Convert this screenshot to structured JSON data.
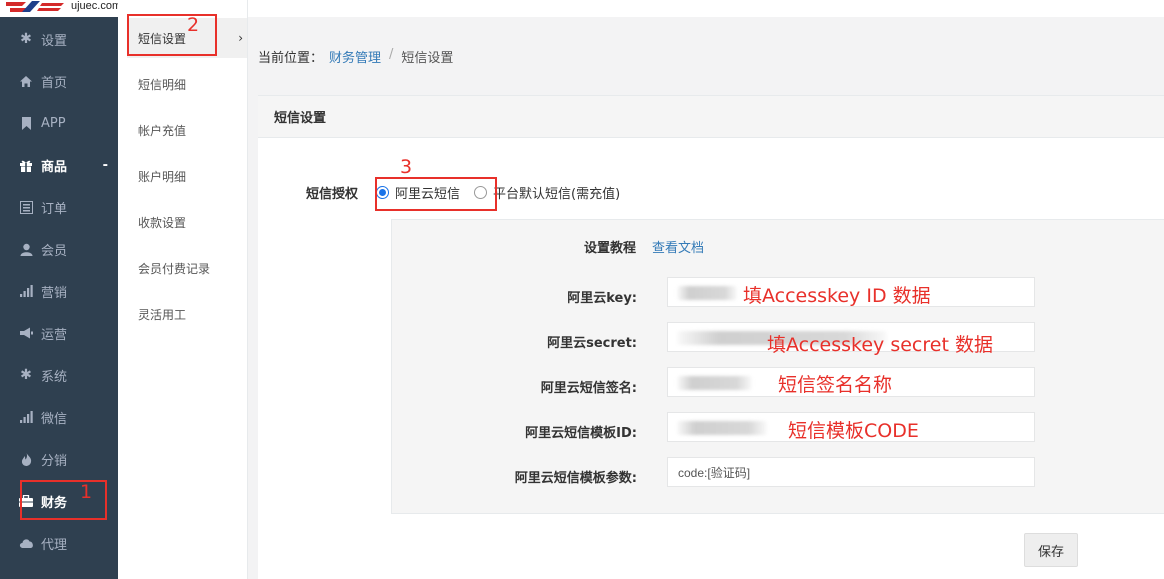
{
  "logo": {
    "text": "ujuec.com"
  },
  "sidebar": {
    "items": [
      {
        "label": "设置",
        "icon": "gear-icon"
      },
      {
        "label": "首页",
        "icon": "home-icon"
      },
      {
        "label": "APP",
        "icon": "bookmark-icon"
      },
      {
        "label": "商品",
        "icon": "gift-icon",
        "suffix": "-"
      },
      {
        "label": "订单",
        "icon": "list-icon"
      },
      {
        "label": "会员",
        "icon": "user-icon"
      },
      {
        "label": "营销",
        "icon": "bar-chart-icon"
      },
      {
        "label": "运营",
        "icon": "megaphone-icon"
      },
      {
        "label": "系统",
        "icon": "asterisk-icon"
      },
      {
        "label": "微信",
        "icon": "signal-icon"
      },
      {
        "label": "分销",
        "icon": "fire-icon"
      },
      {
        "label": "财务",
        "icon": "briefcase-icon"
      },
      {
        "label": "代理",
        "icon": "cloud-icon"
      }
    ]
  },
  "submenu": {
    "items": [
      {
        "label": "短信设置",
        "chevron": "›"
      },
      {
        "label": "短信明细"
      },
      {
        "label": "帐户充值"
      },
      {
        "label": "账户明细"
      },
      {
        "label": "收款设置"
      },
      {
        "label": "会员付费记录"
      },
      {
        "label": "灵活用工"
      }
    ]
  },
  "breadcrumb": {
    "prefix": "当前位置：",
    "parent": "财务管理",
    "separator": "/",
    "current": "短信设置"
  },
  "card": {
    "title": "短信设置",
    "auth_label": "短信授权",
    "options": [
      {
        "label": "阿里云短信",
        "selected": true
      },
      {
        "label": "平台默认短信(需充值)",
        "selected": false
      }
    ],
    "tutorial_label": "设置教程",
    "tutorial_link": "查看文档",
    "fields": [
      {
        "label": "阿里云key:",
        "value": ""
      },
      {
        "label": "阿里云secret:",
        "value": ""
      },
      {
        "label": "阿里云短信签名:",
        "value": ""
      },
      {
        "label": "阿里云短信模板ID:",
        "value": ""
      },
      {
        "label": "阿里云短信模板参数:",
        "value": "code:[验证码]"
      }
    ],
    "save_label": "保存"
  },
  "annotations": {
    "n1": "1",
    "n2": "2",
    "n3": "3",
    "key_hint": "填Accesskey ID 数据",
    "secret_hint": "填Accesskey   secret   数据",
    "sign_hint": "短信签名名称",
    "template_hint": "短信模板CODE"
  },
  "colors": {
    "sidebar_bg": "#2f4050",
    "annotation": "#e8302a",
    "link": "#337ab7"
  }
}
